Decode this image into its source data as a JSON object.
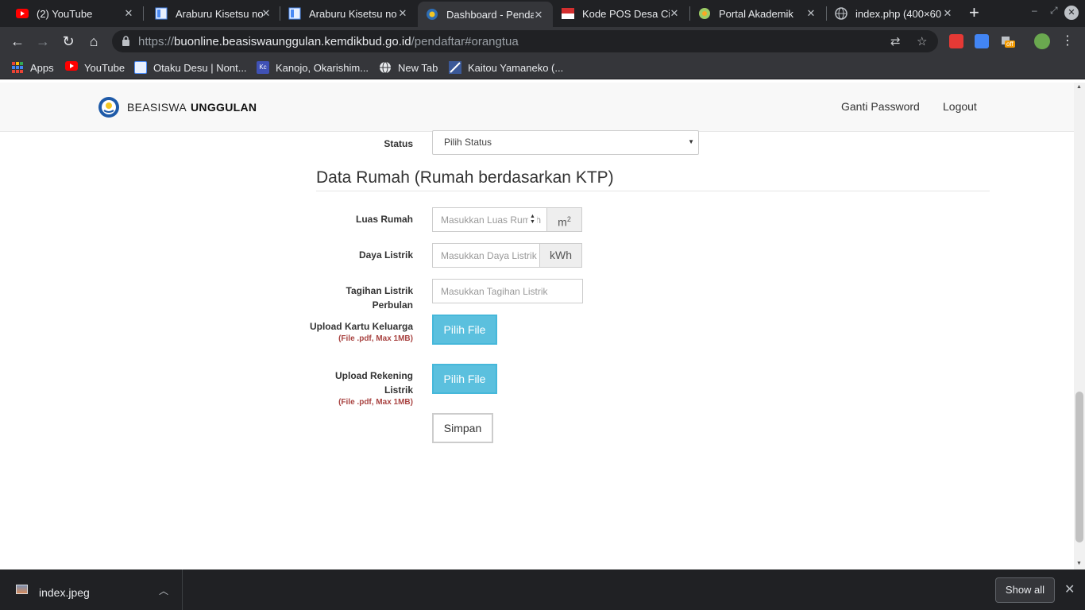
{
  "browser": {
    "tabs": [
      {
        "title": "(2) YouTube",
        "icon": "youtube-icon"
      },
      {
        "title": "Araburu Kisetsu no",
        "icon": "bookmark-page-icon"
      },
      {
        "title": "Araburu Kisetsu no",
        "icon": "bookmark-page-icon"
      },
      {
        "title": "Dashboard - Penda",
        "icon": "kemdikbud-icon",
        "active": true
      },
      {
        "title": "Kode POS Desa Cig",
        "icon": "kodepos-icon"
      },
      {
        "title": "Portal Akademik",
        "icon": "academic-icon"
      },
      {
        "title": "index.php (400×60",
        "icon": "globe-icon"
      }
    ],
    "close_glyph": "✕",
    "new_tab_glyph": "+",
    "url": {
      "scheme": "https://",
      "host": "buonline.beasiswaunggulan.kemdikbud.go.id",
      "path": "/pendaftar#orangtua"
    },
    "ext_badge": "off",
    "bookmarks": [
      {
        "label": "Apps",
        "icon": "apps-grid-icon"
      },
      {
        "label": "YouTube",
        "icon": "youtube-icon"
      },
      {
        "label": "Otaku Desu | Nont...",
        "icon": "otakudesu-icon"
      },
      {
        "label": "Kanojo, Okarishim...",
        "icon": "kc-icon"
      },
      {
        "label": "New Tab",
        "icon": "globe-icon"
      },
      {
        "label": "Kaitou Yamaneko (...",
        "icon": "kaitou-icon"
      }
    ],
    "kc_text": "Kc"
  },
  "site": {
    "brand_light": "BEASISWA",
    "brand_bold": "UNGGULAN",
    "nav": {
      "change_password": "Ganti Password",
      "logout": "Logout"
    }
  },
  "form": {
    "status_label": "Status",
    "status_value": "Pilih Status",
    "section_title": "Data Rumah (Rumah berdasarkan KTP)",
    "luas_rumah": {
      "label": "Luas Rumah",
      "placeholder": "Masukkan Luas Rumah",
      "unit": "m",
      "unit_sup": "2"
    },
    "daya_listrik": {
      "label": "Daya Listrik",
      "placeholder": "Masukkan Daya Listrik",
      "unit": "kWh"
    },
    "tagihan_listrik": {
      "label_line1": "Tagihan Listrik",
      "label_line2": "Perbulan",
      "placeholder": "Masukkan Tagihan Listrik"
    },
    "upload_kk": {
      "label": "Upload Kartu Keluarga",
      "note": "(File .pdf, Max 1MB)",
      "button": "Pilih File"
    },
    "upload_rekening": {
      "label_line1": "Upload Rekening",
      "label_line2": "Listrik",
      "note": "(File .pdf, Max 1MB)",
      "button": "Pilih File"
    },
    "save_button": "Simpan"
  },
  "downloads": {
    "file_name": "index.jpeg",
    "show_all": "Show all"
  }
}
